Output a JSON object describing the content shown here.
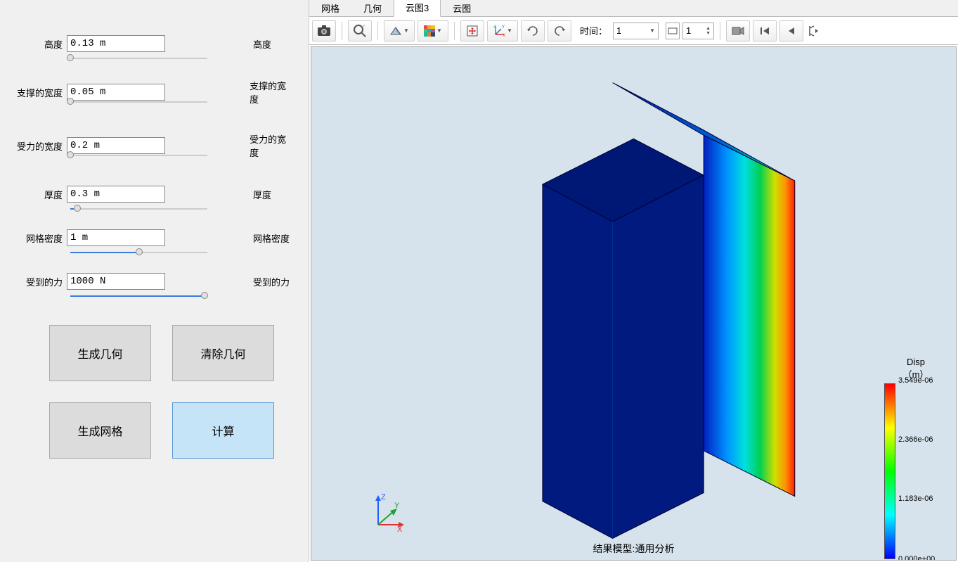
{
  "params": [
    {
      "label_left": "高度",
      "value": "0.13 m",
      "label_right": "高度",
      "thumb_pct": 0,
      "fill_pct": 0,
      "filled": false
    },
    {
      "label_left": "支撑的宽度",
      "value": "0.05 m",
      "label_right": "支撑的宽度",
      "thumb_pct": 0,
      "fill_pct": 0,
      "filled": false
    },
    {
      "label_left": "受力的宽度",
      "value": "0.2 m",
      "label_right": "受力的宽度",
      "thumb_pct": 0,
      "fill_pct": 0,
      "filled": false
    },
    {
      "label_left": "厚度",
      "value": "0.3 m",
      "label_right": "厚度",
      "thumb_pct": 5,
      "fill_pct": 5,
      "filled": true
    },
    {
      "label_left": "网格密度",
      "value": "1 m",
      "label_right": "网格密度",
      "thumb_pct": 50,
      "fill_pct": 50,
      "filled": true
    },
    {
      "label_left": "受到的力",
      "value": "1000 N",
      "label_right": "受到的力",
      "thumb_pct": 98,
      "fill_pct": 100,
      "filled": true
    }
  ],
  "buttons": {
    "gen_geom": "生成几何",
    "clear_geom": "清除几何",
    "gen_mesh": "生成网格",
    "compute": "计算"
  },
  "tabs": [
    "网格",
    "几何",
    "云图3",
    "云图"
  ],
  "active_tab": 2,
  "time_label": "时间：",
  "time_select_value": "1",
  "time_spin_value": "1",
  "status": "结果模型:通用分析",
  "legend": {
    "title1": "Disp",
    "title2": "（m）",
    "ticks": [
      {
        "pos": 0,
        "label": "3.549e-06"
      },
      {
        "pos": 33,
        "label": "2.366e-06"
      },
      {
        "pos": 66,
        "label": "1.183e-06"
      },
      {
        "pos": 100,
        "label": "0.000e+00"
      }
    ]
  },
  "axes": {
    "x": "X",
    "y": "Y",
    "z": "Z"
  }
}
